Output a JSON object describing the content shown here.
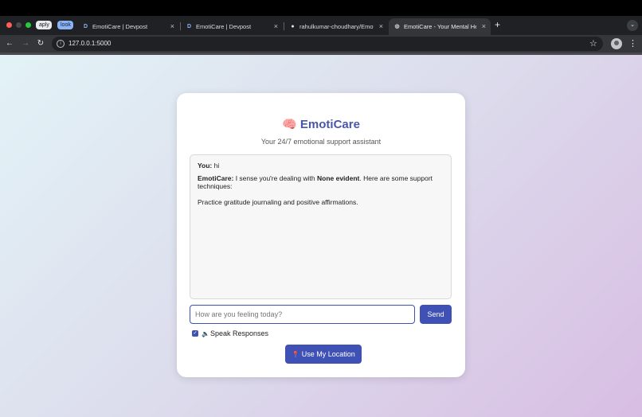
{
  "browser": {
    "tab_groups": [
      {
        "label": "aply"
      },
      {
        "label": "look"
      }
    ],
    "tabs": [
      {
        "favicon": "D",
        "title": "EmotiCare | Devpost",
        "close": "×",
        "active": false
      },
      {
        "favicon": "D",
        "title": "EmotiCare | Devpost",
        "close": "×",
        "active": false
      },
      {
        "favicon": "github-icon",
        "title": "rahulkumar-choudhary/Emot",
        "close": "×",
        "active": false
      },
      {
        "favicon": "globe-icon",
        "title": "EmotiCare - Your Mental Hea",
        "close": "×",
        "active": true
      }
    ],
    "new_tab": "+",
    "tab_menu": "⌄",
    "nav": {
      "back": "←",
      "forward": "→",
      "reload": "↻"
    },
    "url": "127.0.0.1:5000",
    "site_icon": "i",
    "star": "☆",
    "menu": "⋮"
  },
  "app": {
    "title": "🧠 EmotiCare",
    "subtitle": "Your 24/7 emotional support assistant",
    "messages": [
      {
        "speaker": "You:",
        "text": " hi"
      },
      {
        "speaker": "EmotiCare:",
        "pre": " I sense you're dealing with ",
        "emph": "None evident",
        "post": ". Here are some support techniques:"
      },
      {
        "text": "Practice gratitude journaling and positive affirmations."
      }
    ],
    "input": {
      "placeholder": "How are you feeling today?",
      "value": ""
    },
    "send_label": "Send",
    "speak": {
      "checked": true,
      "icon": "🔈",
      "label": "Speak Responses"
    },
    "location_button": {
      "icon": "📍",
      "label": "Use My Location"
    },
    "colors": {
      "accent": "#3f51b5",
      "title": "#4a57a8"
    }
  }
}
